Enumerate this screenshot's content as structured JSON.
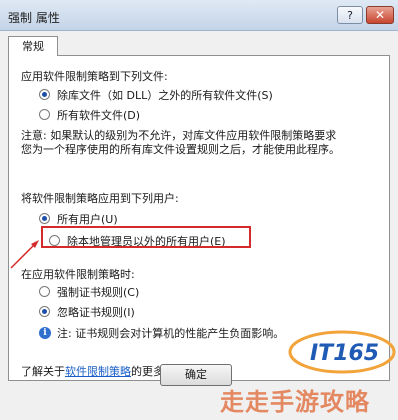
{
  "window": {
    "title": "强制 属性",
    "help_label": "?",
    "close_label": "✕"
  },
  "tab": {
    "label": "常规"
  },
  "files_section": {
    "heading": "应用软件限制策略到下列文件:",
    "options": [
      {
        "label": "除库文件（如 DLL）之外的所有软件文件(S)",
        "checked": true
      },
      {
        "label": "所有软件文件(D)",
        "checked": false
      }
    ],
    "note_line1": "注意: 如果默认的级别为不允许，对库文件应用软件限制策略要求",
    "note_line2": "您为一个程序使用的所有库文件设置规则之后，才能使用此程序。"
  },
  "users_section": {
    "heading": "将软件限制策略应用到下列用户:",
    "options": [
      {
        "label": "所有用户(U)",
        "checked": true
      },
      {
        "label": "除本地管理员以外的所有用户(E)",
        "checked": false
      }
    ]
  },
  "cert_section": {
    "heading": "在应用软件限制策略时:",
    "options": [
      {
        "label": "强制证书规则(C)",
        "checked": false
      },
      {
        "label": "忽略证书规则(I)",
        "checked": true
      }
    ],
    "note": "注: 证书规则会对计算机的性能产生负面影响。"
  },
  "footer": {
    "more_info_prefix": "了解关于",
    "more_info_link": "软件限制策略",
    "more_info_suffix": "的更多信息"
  },
  "buttons": {
    "ok": "确定"
  },
  "watermark": {
    "logo_text": "IT165",
    "site_text": "走走手游攻略"
  },
  "colors": {
    "highlight": "#d42a2a",
    "link": "#1a5fc7",
    "accent": "#1d4fa8"
  }
}
